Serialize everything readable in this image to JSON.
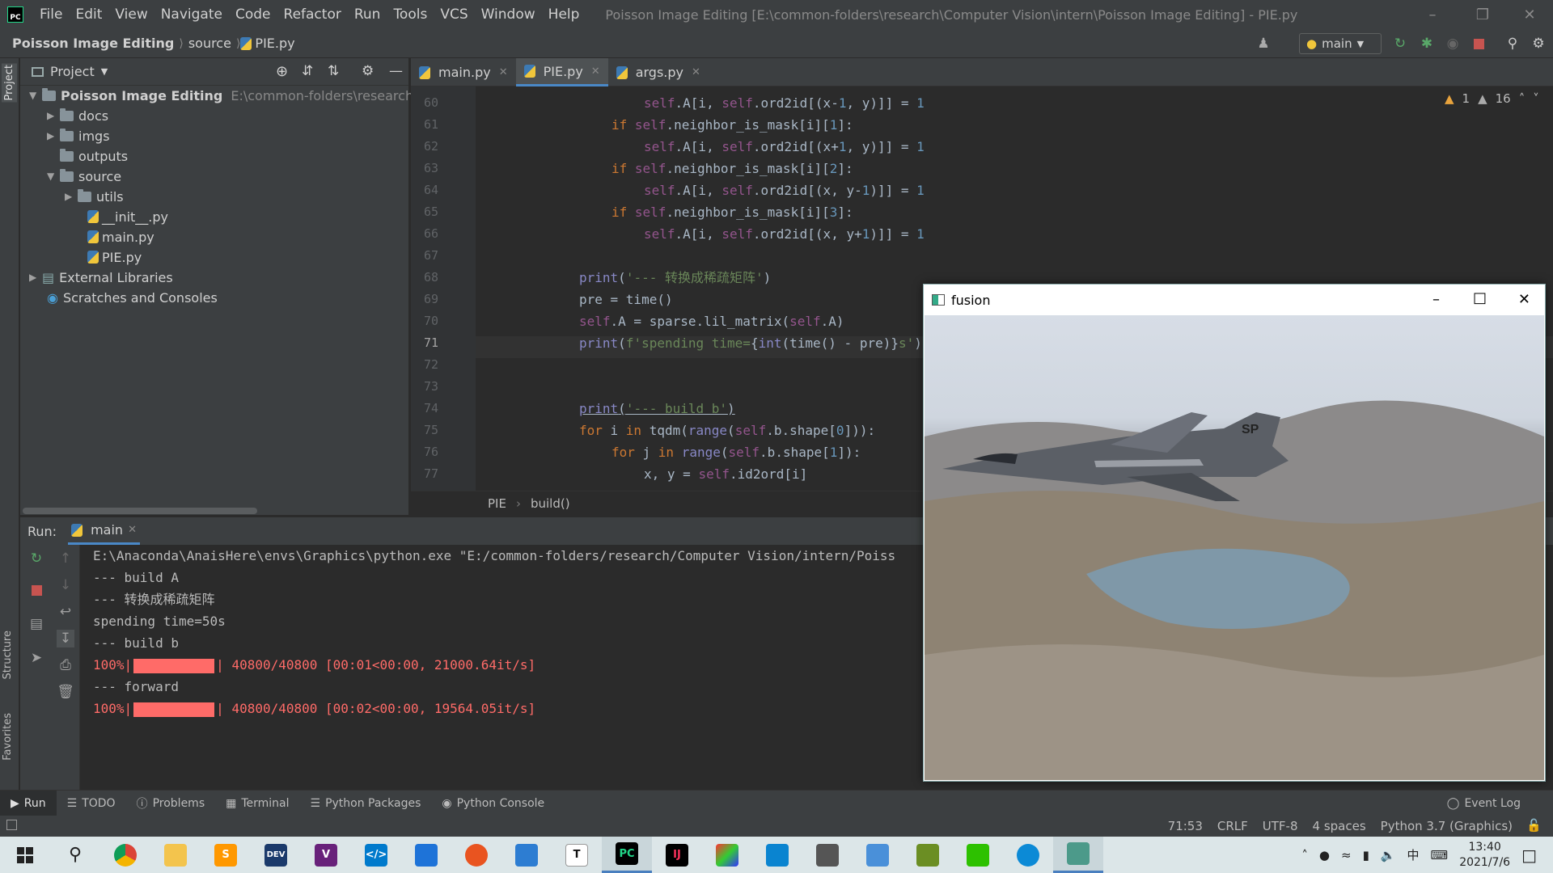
{
  "menu": {
    "items": [
      "File",
      "Edit",
      "View",
      "Navigate",
      "Code",
      "Refactor",
      "Run",
      "Tools",
      "VCS",
      "Window",
      "Help"
    ],
    "window_title": "Poisson Image Editing [E:\\common-folders\\research\\Computer Vision\\intern\\Poisson Image Editing] - PIE.py"
  },
  "nav": {
    "project": "Poisson Image Editing",
    "folder": "source",
    "file": "PIE.py",
    "branch": "main"
  },
  "project_panel": {
    "title": "Project",
    "root_name": "Poisson Image Editing",
    "root_path": "E:\\common-folders\\research\\Comp",
    "items": {
      "docs": "docs",
      "imgs": "imgs",
      "outputs": "outputs",
      "source": "source",
      "utils": "utils",
      "init": "__init__.py",
      "main": "main.py",
      "pie": "PIE.py",
      "ext": "External Libraries",
      "scratches": "Scratches and Consoles"
    }
  },
  "tabs": [
    "main.py",
    "PIE.py",
    "args.py"
  ],
  "inspection": {
    "warnings": "1",
    "weak": "16"
  },
  "code": {
    "line_numbers": [
      "60",
      "61",
      "62",
      "63",
      "64",
      "65",
      "66",
      "67",
      "68",
      "69",
      "70",
      "71",
      "72",
      "73",
      "74",
      "75",
      "76",
      "77"
    ],
    "current_line": "71"
  },
  "breadcrumb": {
    "cls": "PIE",
    "method": "build()"
  },
  "run": {
    "label": "Run:",
    "config": "main",
    "lines": [
      "E:\\Anaconda\\AnaisHere\\envs\\Graphics\\python.exe \"E:/common-folders/research/Computer Vision/intern/Poiss",
      "--- build A",
      "--- 转换成稀疏矩阵",
      "spending time=50s",
      "--- build b"
    ],
    "progress1": {
      "prefix": "100%|",
      "suffix": "| 40800/40800 [00:01<00:00, 21000.64it/s]",
      "fraction": 1.0
    },
    "forward": "--- forward",
    "progress2": {
      "prefix": "100%|",
      "suffix": "| 40800/40800 [00:02<00:00, 19564.05it/s]",
      "fraction": 1.0
    }
  },
  "left_strip": {
    "project": "Project",
    "structure": "Structure",
    "favorites": "Favorites"
  },
  "bottom_tabs": [
    "Run",
    "TODO",
    "Problems",
    "Terminal",
    "Python Packages",
    "Python Console"
  ],
  "event_log": "Event Log",
  "status": {
    "position": "71:53",
    "line_sep": "CRLF",
    "encoding": "UTF-8",
    "indent": "4 spaces",
    "interpreter": "Python 3.7 (Graphics)"
  },
  "fusion_window": {
    "title": "fusion",
    "tail_text": "SP"
  },
  "taskbar": {
    "clock_time": "13:40",
    "clock_date": "2021/7/6",
    "ime": "中"
  },
  "colors": {
    "accent": "#4a88c7",
    "keyword": "#cc7832",
    "string": "#6a8759",
    "number": "#6897bb",
    "self": "#94558d",
    "error": "#ff6b68"
  }
}
